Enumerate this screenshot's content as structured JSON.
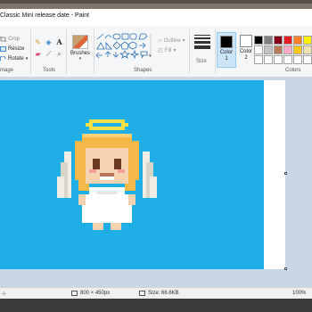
{
  "window": {
    "title": "Classic Mini release date - Paint"
  },
  "ribbon": {
    "image": {
      "crop": "Crop",
      "resize": "Resize",
      "rotate": "Rotate",
      "group": "mage"
    },
    "tools": {
      "group": "Tools"
    },
    "brushes": {
      "label": "Brushes"
    },
    "shapes": {
      "outline": "Outline",
      "fill": "Fill",
      "group": "Shapes"
    },
    "size": {
      "label": "Size"
    },
    "color1": {
      "label": "Color",
      "num": "1",
      "value": "#000000"
    },
    "color2": {
      "label": "Color",
      "num": "2",
      "value": "#ffffff"
    },
    "colors": {
      "group": "Colors",
      "palette_row1": [
        "#000000",
        "#7f7f7f",
        "#880015",
        "#ed1c24",
        "#ff7f27",
        "#fff200"
      ],
      "palette_row2": [
        "#ffffff",
        "#c3c3c3",
        "#b97a57",
        "#ffaec9",
        "#ffc90e",
        "#efe4b0"
      ],
      "palette_row3": [
        "#ffffff",
        "#ffffff",
        "#ffffff",
        "#ffffff",
        "#ffffff",
        "#ffffff"
      ]
    }
  },
  "canvas": {
    "background": "#1faee6"
  },
  "status": {
    "dimensions": "800 × 450px",
    "size": "Size: 66.6KB",
    "zoom": "100%"
  }
}
